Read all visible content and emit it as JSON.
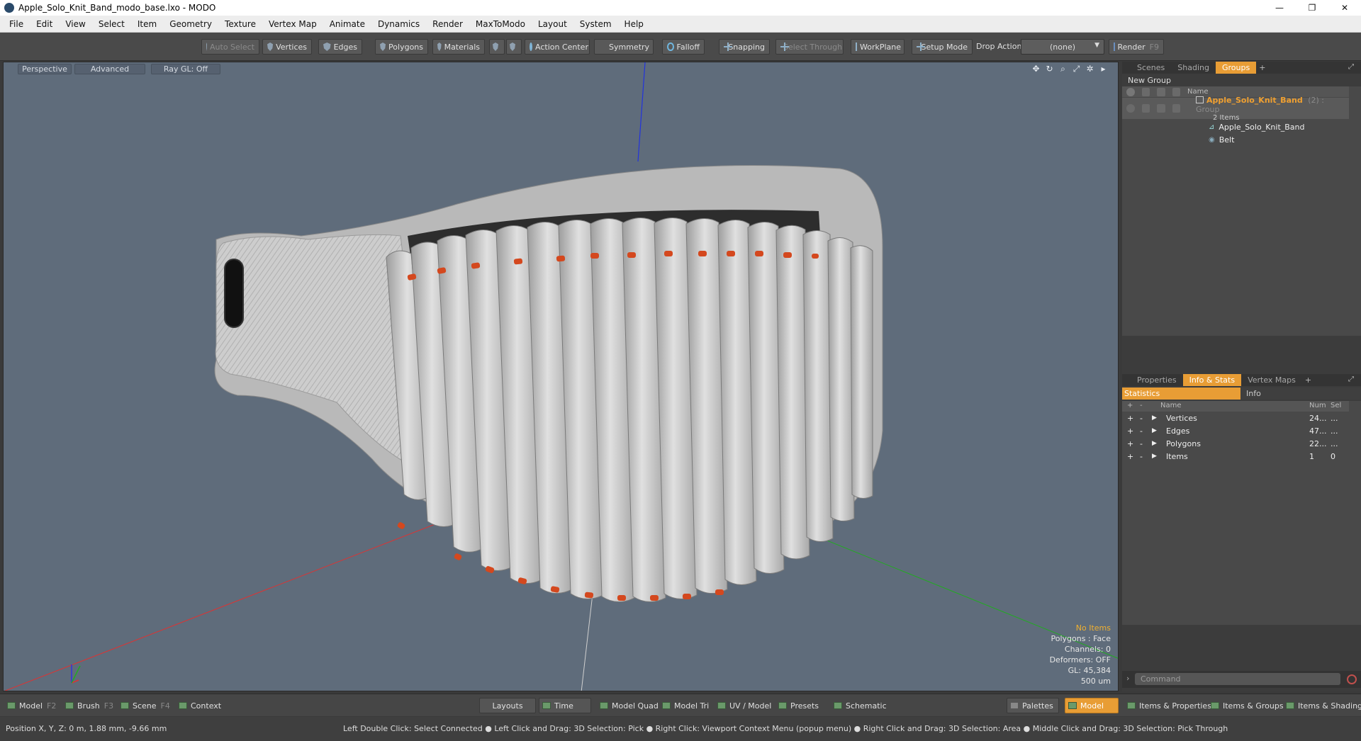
{
  "window": {
    "title": "Apple_Solo_Knit_Band_modo_base.lxo - MODO",
    "controls": [
      "—",
      "❐",
      "✕"
    ]
  },
  "menu": [
    "File",
    "Edit",
    "View",
    "Select",
    "Item",
    "Geometry",
    "Texture",
    "Vertex Map",
    "Animate",
    "Dynamics",
    "Render",
    "MaxToModo",
    "Layout",
    "System",
    "Help"
  ],
  "toolbar": {
    "auto_select": "Auto Select",
    "vertices": "Vertices",
    "edges": "Edges",
    "polygons": "Polygons",
    "materials": "Materials",
    "action_center": "Action Center",
    "symmetry": "Symmetry",
    "falloff": "Falloff",
    "snapping": "Snapping",
    "select_through": "Select Through",
    "workplane": "WorkPlane",
    "setup_mode": "Setup Mode",
    "drop_action_label": "Drop Action",
    "drop_action_value": "(none)",
    "render": "Render",
    "render_key": "F9"
  },
  "viewport": {
    "tabs": [
      "Perspective",
      "Advanced",
      "Ray GL: Off"
    ],
    "icons": [
      "move-icon",
      "rotate-icon",
      "zoom-icon",
      "maximize-icon",
      "settings-icon",
      "arrow-icon"
    ],
    "stats": {
      "no_items": "No Items",
      "polygons": "Polygons : Face",
      "channels": "Channels: 0",
      "deformers": "Deformers: OFF",
      "gl": "GL: 45,384",
      "scale": "500 um"
    },
    "band_light": "#c9c9c9",
    "accent_red": "#d4481e"
  },
  "groups_panel": {
    "tabs": [
      "Scenes",
      "Shading",
      "Groups"
    ],
    "active_tab": "Groups",
    "new_group": "New Group",
    "name_header": "Name",
    "group_name": "Apple_Solo_Knit_Band",
    "group_suffix": "(2) : Group",
    "group_count": "2 Items",
    "children": [
      "Apple_Solo_Knit_Band",
      "Belt"
    ]
  },
  "info_panel": {
    "tabs": [
      "Properties",
      "Info & Stats",
      "Vertex Maps"
    ],
    "active_tab": "Info & Stats",
    "sub_tabs": [
      "Statistics",
      "Info"
    ],
    "columns": [
      "Name",
      "Num",
      "Sel"
    ],
    "rows": [
      {
        "name": "Vertices",
        "num": "24...",
        "sel": "..."
      },
      {
        "name": "Edges",
        "num": "47...",
        "sel": "..."
      },
      {
        "name": "Polygons",
        "num": "22...",
        "sel": "..."
      },
      {
        "name": "Items",
        "num": "1",
        "sel": "0"
      }
    ],
    "command_placeholder": "Command"
  },
  "bottom_bar": {
    "left": [
      {
        "label": "Model",
        "key": "F2"
      },
      {
        "label": "Brush",
        "key": "F3"
      },
      {
        "label": "Scene",
        "key": "F4"
      },
      {
        "label": "Context",
        "key": ""
      }
    ],
    "center": [
      "Layouts",
      "Time",
      "Model Quad",
      "Model Tri",
      "UV / Model",
      "Presets",
      "Schematic"
    ],
    "right": [
      "Palettes",
      "Model",
      "Items & Properties",
      "Items & Groups",
      "Items & Shading"
    ],
    "active": "Model"
  },
  "status": {
    "position": "Position X, Y, Z:  0 m, 1.88 mm, -9.66 mm",
    "hint": "Left Double Click: Select Connected ● Left Click and Drag: 3D Selection: Pick ● Right Click: Viewport Context Menu (popup menu) ● Right Click and Drag: 3D Selection: Area ● Middle Click and Drag: 3D Selection: Pick Through"
  }
}
